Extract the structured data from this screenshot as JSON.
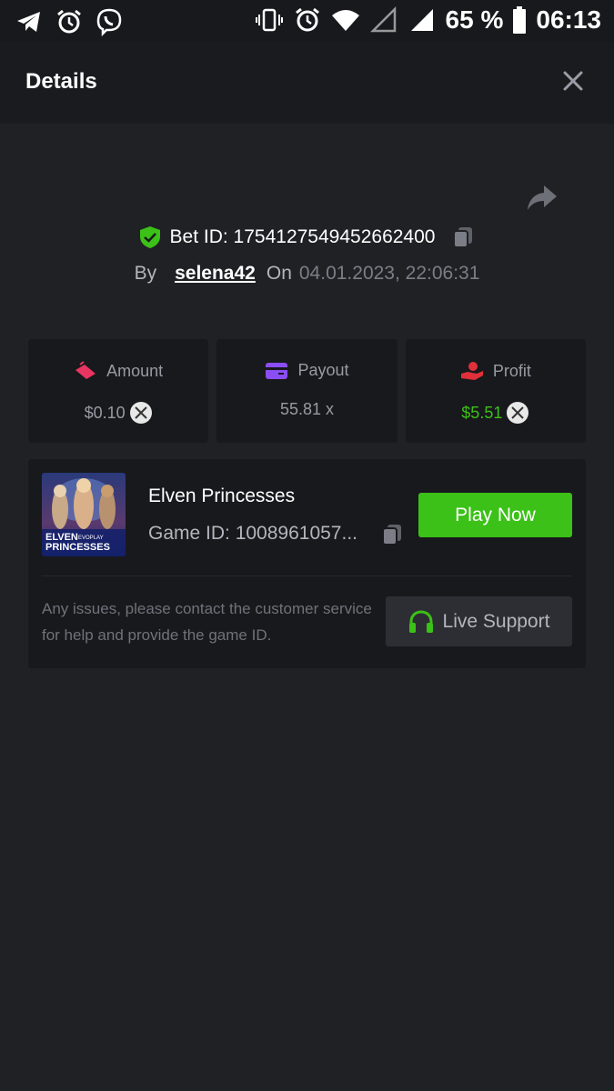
{
  "status_bar": {
    "battery": "65 %",
    "time": "06:13"
  },
  "header": {
    "title": "Details"
  },
  "bet": {
    "id_label": "Bet ID: 1754127549452662400",
    "by_label": "By",
    "user": "selena42",
    "on_label": "On",
    "datetime": "04.01.2023, 22:06:31"
  },
  "stats": {
    "amount": {
      "label": "Amount",
      "value": "$0.10",
      "icon": "amount-icon"
    },
    "payout": {
      "label": "Payout",
      "value": "55.81 x",
      "icon": "card-icon"
    },
    "profit": {
      "label": "Profit",
      "value": "$5.51",
      "icon": "profit-hand-icon"
    }
  },
  "game": {
    "name": "Elven Princesses",
    "id_text": "Game ID: 1008961057...",
    "play_label": "Play Now",
    "thumb_title_line1": "ELVEN",
    "thumb_brand": "EVOPLAY",
    "thumb_title_line2": "PRINCESSES"
  },
  "support": {
    "message": "Any issues, please contact the customer service for help and provide the game ID.",
    "button_label": "Live Support"
  },
  "colors": {
    "accent_green": "#3bc117",
    "background": "#202125",
    "card": "#18191c"
  }
}
